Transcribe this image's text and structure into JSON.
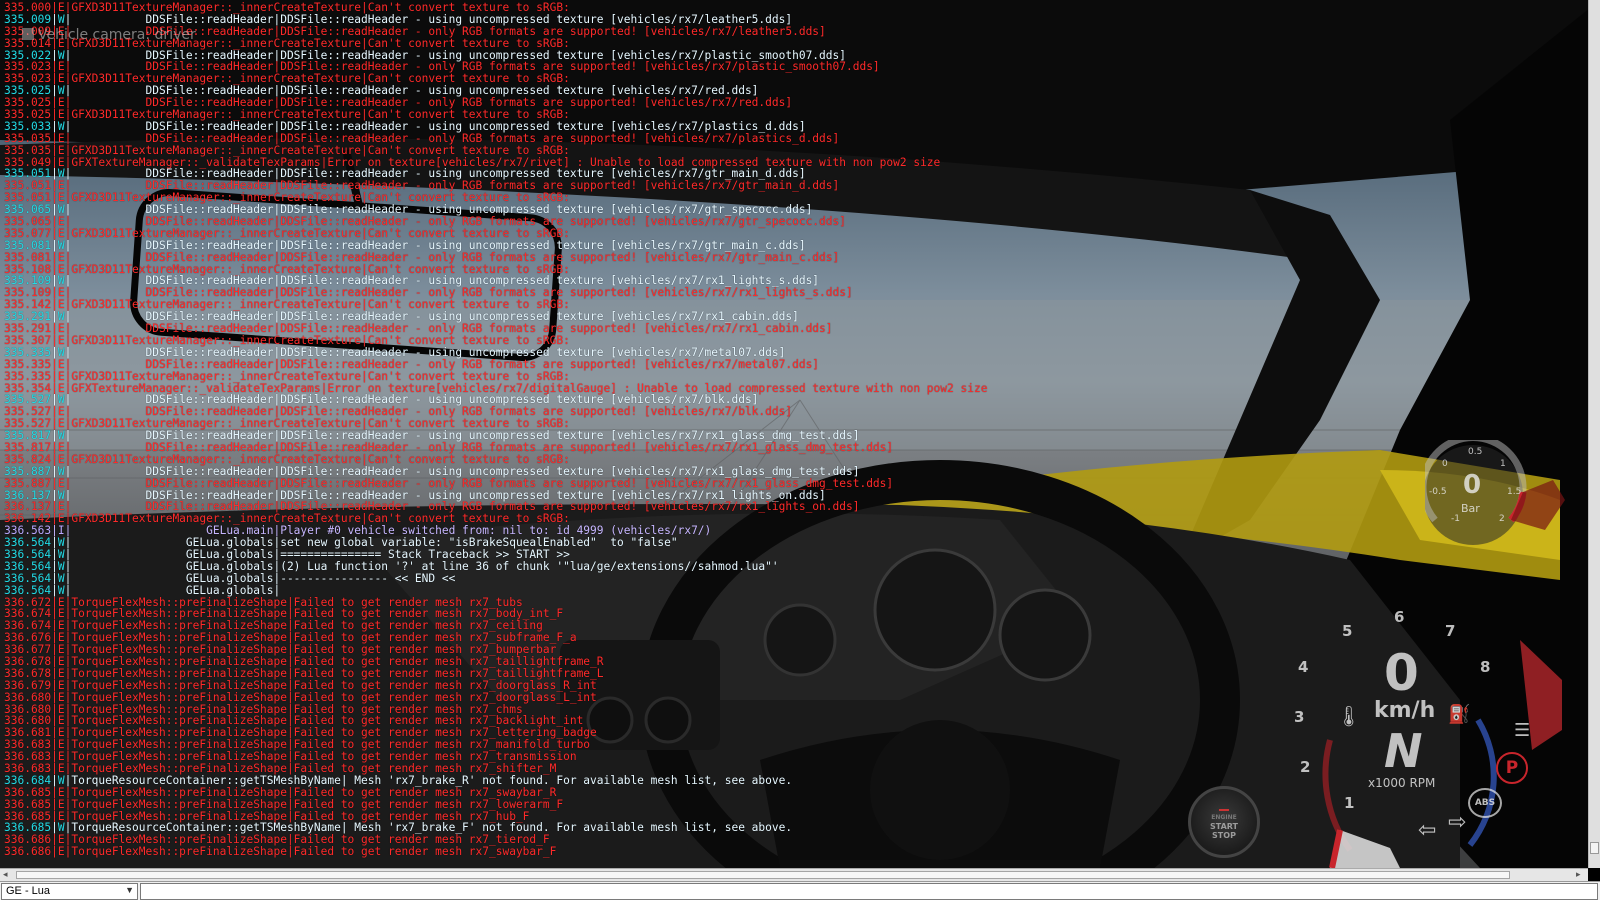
{
  "camera_label": "Vehicle camera: driver",
  "console": {
    "lines": [
      {
        "ts": "335.000",
        "lv": "E",
        "msg": "GFXD3D11TextureManager::_innerCreateTexture|Can't convert texture to sRGB:"
      },
      {
        "ts": "335.009",
        "lv": "W",
        "msg": "           DDSFile::readHeader|DDSFile::readHeader - using uncompressed texture [vehicles/rx7/leather5.dds]"
      },
      {
        "ts": "335.009",
        "lv": "E",
        "msg": "           DDSFile::readHeader|DDSFile::readHeader - only RGB formats are supported! [vehicles/rx7/leather5.dds]"
      },
      {
        "ts": "335.014",
        "lv": "E",
        "msg": "GFXD3D11TextureManager::_innerCreateTexture|Can't convert texture to sRGB:"
      },
      {
        "ts": "335.022",
        "lv": "W",
        "msg": "           DDSFile::readHeader|DDSFile::readHeader - using uncompressed texture [vehicles/rx7/plastic_smooth07.dds]"
      },
      {
        "ts": "335.023",
        "lv": "E",
        "msg": "           DDSFile::readHeader|DDSFile::readHeader - only RGB formats are supported! [vehicles/rx7/plastic_smooth07.dds]"
      },
      {
        "ts": "335.023",
        "lv": "E",
        "msg": "GFXD3D11TextureManager::_innerCreateTexture|Can't convert texture to sRGB:"
      },
      {
        "ts": "335.025",
        "lv": "W",
        "msg": "           DDSFile::readHeader|DDSFile::readHeader - using uncompressed texture [vehicles/rx7/red.dds]"
      },
      {
        "ts": "335.025",
        "lv": "E",
        "msg": "           DDSFile::readHeader|DDSFile::readHeader - only RGB formats are supported! [vehicles/rx7/red.dds]"
      },
      {
        "ts": "335.025",
        "lv": "E",
        "msg": "GFXD3D11TextureManager::_innerCreateTexture|Can't convert texture to sRGB:"
      },
      {
        "ts": "335.033",
        "lv": "W",
        "msg": "           DDSFile::readHeader|DDSFile::readHeader - using uncompressed texture [vehicles/rx7/plastics_d.dds]"
      },
      {
        "ts": "335.035",
        "lv": "E",
        "msg": "           DDSFile::readHeader|DDSFile::readHeader - only RGB formats are supported! [vehicles/rx7/plastics_d.dds]"
      },
      {
        "ts": "335.035",
        "lv": "E",
        "msg": "GFXD3D11TextureManager::_innerCreateTexture|Can't convert texture to sRGB:"
      },
      {
        "ts": "335.049",
        "lv": "E",
        "msg": "GFXTextureManager::_validateTexParams|Error on texture[vehicles/rx7/rivet] : Unable to load compressed texture with non pow2 size"
      },
      {
        "ts": "335.051",
        "lv": "W",
        "msg": "           DDSFile::readHeader|DDSFile::readHeader - using uncompressed texture [vehicles/rx7/gtr_main_d.dds]"
      },
      {
        "ts": "335.051",
        "lv": "E",
        "msg": "           DDSFile::readHeader|DDSFile::readHeader - only RGB formats are supported! [vehicles/rx7/gtr_main_d.dds]"
      },
      {
        "ts": "335.051",
        "lv": "E",
        "msg": "GFXD3D11TextureManager::_innerCreateTexture|Can't convert texture to sRGB:"
      },
      {
        "ts": "335.065",
        "lv": "W",
        "msg": "           DDSFile::readHeader|DDSFile::readHeader - using uncompressed texture [vehicles/rx7/gtr_specocc.dds]"
      },
      {
        "ts": "335.065",
        "lv": "E",
        "msg": "           DDSFile::readHeader|DDSFile::readHeader - only RGB formats are supported! [vehicles/rx7/gtr_specocc.dds]"
      },
      {
        "ts": "335.077",
        "lv": "E",
        "msg": "GFXD3D11TextureManager::_innerCreateTexture|Can't convert texture to sRGB:"
      },
      {
        "ts": "335.081",
        "lv": "W",
        "msg": "           DDSFile::readHeader|DDSFile::readHeader - using uncompressed texture [vehicles/rx7/gtr_main_c.dds]"
      },
      {
        "ts": "335.081",
        "lv": "E",
        "msg": "           DDSFile::readHeader|DDSFile::readHeader - only RGB formats are supported! [vehicles/rx7/gtr_main_c.dds]"
      },
      {
        "ts": "335.108",
        "lv": "E",
        "msg": "GFXD3D11TextureManager::_innerCreateTexture|Can't convert texture to sRGB:"
      },
      {
        "ts": "335.109",
        "lv": "W",
        "msg": "           DDSFile::readHeader|DDSFile::readHeader - using uncompressed texture [vehicles/rx7/rx1_lights_s.dds]"
      },
      {
        "ts": "335.109",
        "lv": "E",
        "msg": "           DDSFile::readHeader|DDSFile::readHeader - only RGB formats are supported! [vehicles/rx7/rx1_lights_s.dds]"
      },
      {
        "ts": "335.142",
        "lv": "E",
        "msg": "GFXD3D11TextureManager::_innerCreateTexture|Can't convert texture to sRGB:"
      },
      {
        "ts": "335.291",
        "lv": "W",
        "msg": "           DDSFile::readHeader|DDSFile::readHeader - using uncompressed texture [vehicles/rx7/rx1_cabin.dds]"
      },
      {
        "ts": "335.291",
        "lv": "E",
        "msg": "           DDSFile::readHeader|DDSFile::readHeader - only RGB formats are supported! [vehicles/rx7/rx1_cabin.dds]"
      },
      {
        "ts": "335.307",
        "lv": "E",
        "msg": "GFXD3D11TextureManager::_innerCreateTexture|Can't convert texture to sRGB:"
      },
      {
        "ts": "335.335",
        "lv": "W",
        "msg": "           DDSFile::readHeader|DDSFile::readHeader - using uncompressed texture [vehicles/rx7/metal07.dds]"
      },
      {
        "ts": "335.335",
        "lv": "E",
        "msg": "           DDSFile::readHeader|DDSFile::readHeader - only RGB formats are supported! [vehicles/rx7/metal07.dds]"
      },
      {
        "ts": "335.335",
        "lv": "E",
        "msg": "GFXD3D11TextureManager::_innerCreateTexture|Can't convert texture to sRGB:"
      },
      {
        "ts": "335.354",
        "lv": "E",
        "msg": "GFXTextureManager::_validateTexParams|Error on texture[vehicles/rx7/digitalGauge] : Unable to load compressed texture with non pow2 size"
      },
      {
        "ts": "335.527",
        "lv": "W",
        "msg": "           DDSFile::readHeader|DDSFile::readHeader - using uncompressed texture [vehicles/rx7/blk.dds]"
      },
      {
        "ts": "335.527",
        "lv": "E",
        "msg": "           DDSFile::readHeader|DDSFile::readHeader - only RGB formats are supported! [vehicles/rx7/blk.dds]"
      },
      {
        "ts": "335.527",
        "lv": "E",
        "msg": "GFXD3D11TextureManager::_innerCreateTexture|Can't convert texture to sRGB:"
      },
      {
        "ts": "335.817",
        "lv": "W",
        "msg": "           DDSFile::readHeader|DDSFile::readHeader - using uncompressed texture [vehicles/rx7/rx1_glass_dmg_test.dds]"
      },
      {
        "ts": "335.817",
        "lv": "E",
        "msg": "           DDSFile::readHeader|DDSFile::readHeader - only RGB formats are supported! [vehicles/rx7/rx1_glass_dmg_test.dds]"
      },
      {
        "ts": "335.824",
        "lv": "E",
        "msg": "GFXD3D11TextureManager::_innerCreateTexture|Can't convert texture to sRGB:"
      },
      {
        "ts": "335.887",
        "lv": "W",
        "msg": "           DDSFile::readHeader|DDSFile::readHeader - using uncompressed texture [vehicles/rx7/rx1_glass_dmg_test.dds]"
      },
      {
        "ts": "335.887",
        "lv": "E",
        "msg": "           DDSFile::readHeader|DDSFile::readHeader - only RGB formats are supported! [vehicles/rx7/rx1_glass_dmg_test.dds]"
      },
      {
        "ts": "336.137",
        "lv": "W",
        "msg": "           DDSFile::readHeader|DDSFile::readHeader - using uncompressed texture [vehicles/rx7/rx1_lights_on.dds]"
      },
      {
        "ts": "336.137",
        "lv": "E",
        "msg": "           DDSFile::readHeader|DDSFile::readHeader - only RGB formats are supported! [vehicles/rx7/rx1_lights_on.dds]"
      },
      {
        "ts": "336.142",
        "lv": "E",
        "msg": "GFXD3D11TextureManager::_innerCreateTexture|Can't convert texture to sRGB:"
      },
      {
        "ts": "336.563",
        "lv": "I",
        "msg": "                    GELua.main|Player #0 vehicle switched from: nil to: id 4999 (vehicles/rx7/)"
      },
      {
        "ts": "336.564",
        "lv": "W",
        "msg": "                 GELua.globals|set new global variable: \"isBrakeSquealEnabled\"  to \"false\""
      },
      {
        "ts": "336.564",
        "lv": "W",
        "msg": "                 GELua.globals|=============== Stack Traceback >> START >>"
      },
      {
        "ts": "336.564",
        "lv": "W",
        "msg": "                 GELua.globals|(2) Lua function '?' at line 36 of chunk '\"lua/ge/extensions//sahmod.lua\"'"
      },
      {
        "ts": "336.564",
        "lv": "W",
        "msg": "                 GELua.globals|---------------- << END <<"
      },
      {
        "ts": "336.564",
        "lv": "W",
        "msg": "                 GELua.globals|"
      },
      {
        "ts": "336.672",
        "lv": "E",
        "msg": "TorqueFlexMesh::preFinalizeShape|Failed to get render mesh rx7_tubs"
      },
      {
        "ts": "336.674",
        "lv": "E",
        "msg": "TorqueFlexMesh::preFinalizeShape|Failed to get render mesh rx7_body_int_F"
      },
      {
        "ts": "336.674",
        "lv": "E",
        "msg": "TorqueFlexMesh::preFinalizeShape|Failed to get render mesh rx7_ceiling"
      },
      {
        "ts": "336.676",
        "lv": "E",
        "msg": "TorqueFlexMesh::preFinalizeShape|Failed to get render mesh rx7_subframe_F_a"
      },
      {
        "ts": "336.677",
        "lv": "E",
        "msg": "TorqueFlexMesh::preFinalizeShape|Failed to get render mesh rx7_bumperbar"
      },
      {
        "ts": "336.678",
        "lv": "E",
        "msg": "TorqueFlexMesh::preFinalizeShape|Failed to get render mesh rx7_taillightframe_R"
      },
      {
        "ts": "336.678",
        "lv": "E",
        "msg": "TorqueFlexMesh::preFinalizeShape|Failed to get render mesh rx7_taillightframe_L"
      },
      {
        "ts": "336.679",
        "lv": "E",
        "msg": "TorqueFlexMesh::preFinalizeShape|Failed to get render mesh rx7_doorglass_R_int"
      },
      {
        "ts": "336.680",
        "lv": "E",
        "msg": "TorqueFlexMesh::preFinalizeShape|Failed to get render mesh rx7_doorglass_L_int"
      },
      {
        "ts": "336.680",
        "lv": "E",
        "msg": "TorqueFlexMesh::preFinalizeShape|Failed to get render mesh rx7_chms"
      },
      {
        "ts": "336.680",
        "lv": "E",
        "msg": "TorqueFlexMesh::preFinalizeShape|Failed to get render mesh rx7_backlight_int"
      },
      {
        "ts": "336.681",
        "lv": "E",
        "msg": "TorqueFlexMesh::preFinalizeShape|Failed to get render mesh rx7_lettering_badge"
      },
      {
        "ts": "336.683",
        "lv": "E",
        "msg": "TorqueFlexMesh::preFinalizeShape|Failed to get render mesh rx7_manifold_turbo"
      },
      {
        "ts": "336.683",
        "lv": "E",
        "msg": "TorqueFlexMesh::preFinalizeShape|Failed to get render mesh rx7_transmission"
      },
      {
        "ts": "336.683",
        "lv": "E",
        "msg": "TorqueFlexMesh::preFinalizeShape|Failed to get render mesh rx7_shifter_M"
      },
      {
        "ts": "336.684",
        "lv": "W",
        "msg": "TorqueResourceContainer::getTSMeshByName| Mesh 'rx7_brake_R' not found. For available mesh list, see above."
      },
      {
        "ts": "336.685",
        "lv": "E",
        "msg": "TorqueFlexMesh::preFinalizeShape|Failed to get render mesh rx7_swaybar_R"
      },
      {
        "ts": "336.685",
        "lv": "E",
        "msg": "TorqueFlexMesh::preFinalizeShape|Failed to get render mesh rx7_lowerarm_F"
      },
      {
        "ts": "336.685",
        "lv": "E",
        "msg": "TorqueFlexMesh::preFinalizeShape|Failed to get render mesh rx7_hub_F"
      },
      {
        "ts": "336.685",
        "lv": "W",
        "msg": "TorqueResourceContainer::getTSMeshByName| Mesh 'rx7_brake_F' not found. For available mesh list, see above."
      },
      {
        "ts": "336.686",
        "lv": "E",
        "msg": "TorqueFlexMesh::preFinalizeShape|Failed to get render mesh rx7_tierod_F"
      },
      {
        "ts": "336.686",
        "lv": "E",
        "msg": "TorqueFlexMesh::preFinalizeShape|Failed to get render mesh rx7_swaybar_F"
      }
    ]
  },
  "hud": {
    "boost": {
      "value": "0",
      "unit": "Bar",
      "ticks": [
        "-1",
        "-0.5",
        "0",
        "0.5",
        "1",
        "1.5",
        "2"
      ]
    },
    "tacho": {
      "speed": "0",
      "speed_unit": "km/h",
      "gear": "N",
      "rpm_label": "x1000 RPM",
      "rpm_ticks": [
        "1",
        "2",
        "3",
        "4",
        "5",
        "6",
        "7",
        "8"
      ]
    },
    "icons": [
      "temperature-icon",
      "fuel-icon",
      "headlight-icon",
      "parking-brake-icon",
      "abs-icon",
      "left-turn-signal-icon",
      "right-turn-signal-icon"
    ],
    "parking_label": "P",
    "abs_label": "ABS",
    "engine_button": {
      "top": "ENGINE",
      "mid1": "START",
      "mid2": "STOP"
    }
  },
  "input_bar": {
    "context": "GE - Lua",
    "command_value": ""
  },
  "colors": {
    "warn_ts": "#22dbe6",
    "error": "#ff2a2a",
    "info": "#b9a7ff",
    "hud_red": "#c8252c",
    "hud_blue": "#2f4fa8"
  }
}
